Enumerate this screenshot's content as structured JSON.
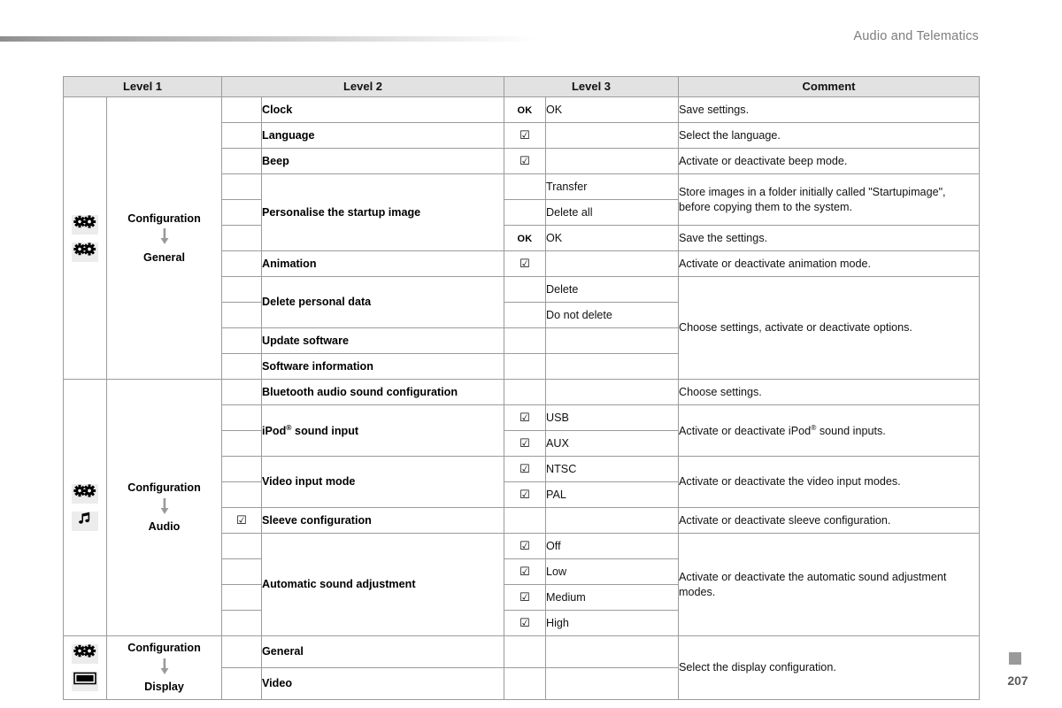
{
  "header": {
    "title": "Audio and Telematics"
  },
  "footer": {
    "page_number": "207"
  },
  "table": {
    "columns": [
      "Level 1",
      "Level 2",
      "Level 3",
      "Comment"
    ],
    "icons": {
      "gear": "gears-icon",
      "music": "music-note-icon",
      "screen": "display-screen-icon"
    },
    "marks": {
      "ok": "OK",
      "checkbox": "☑"
    },
    "sections": [
      {
        "id": "general",
        "icon_top": "gears-icon",
        "icon_bottom": "gears-icon",
        "level1_top": "Configuration",
        "level1_bottom": "General",
        "rows": [
          {
            "level2": "Clock",
            "mark3": "OK",
            "level3": "OK",
            "comment": "Save settings."
          },
          {
            "level2": "Language",
            "mark3": "checkbox",
            "level3": "",
            "comment": "Select the language."
          },
          {
            "level2": "Beep",
            "mark3": "checkbox",
            "level3": "",
            "comment": "Activate or deactivate beep mode."
          },
          {
            "level2": "Personalise the startup image",
            "mark3": "",
            "level3": "Transfer",
            "comment": "Store images in a folder initially called \"Startupimage\", before copying them to the system."
          },
          {
            "level2": "",
            "mark3": "",
            "level3": "Delete all",
            "comment": ""
          },
          {
            "level2": "",
            "mark3": "OK",
            "level3": "OK",
            "comment": "Save the settings."
          },
          {
            "level2": "Animation",
            "mark3": "checkbox",
            "level3": "",
            "comment": "Activate or deactivate animation mode."
          },
          {
            "level2": "Delete personal data",
            "mark3": "",
            "level3": "Delete",
            "comment": "Choose settings, activate or deactivate options."
          },
          {
            "level2": "",
            "mark3": "",
            "level3": "Do not delete",
            "comment": ""
          },
          {
            "level2": "Update software",
            "mark3": "",
            "level3": "",
            "comment": ""
          },
          {
            "level2": "Software information",
            "mark3": "",
            "level3": "",
            "comment": ""
          }
        ]
      },
      {
        "id": "audio",
        "icon_top": "gears-icon",
        "icon_bottom": "music-note-icon",
        "level1_top": "Configuration",
        "level1_bottom": "Audio",
        "rows": [
          {
            "level2": "Bluetooth audio sound configuration",
            "mark3": "",
            "level3": "",
            "comment": "Choose settings."
          },
          {
            "level2": "iPod® sound input",
            "mark3": "checkbox",
            "level3": "USB",
            "comment": "Activate or deactivate iPod® sound inputs."
          },
          {
            "level2": "",
            "mark3": "checkbox",
            "level3": "AUX",
            "comment": ""
          },
          {
            "level2": "Video input mode",
            "mark3": "checkbox",
            "level3": "NTSC",
            "comment": "Activate or deactivate the video input modes."
          },
          {
            "level2": "",
            "mark3": "checkbox",
            "level3": "PAL",
            "comment": ""
          },
          {
            "level2": "Sleeve configuration",
            "mark2": "checkbox",
            "mark3": "",
            "level3": "",
            "comment": "Activate or deactivate sleeve configuration."
          },
          {
            "level2": "Automatic sound adjustment",
            "mark3": "checkbox",
            "level3": "Off",
            "comment": "Activate or deactivate the automatic sound adjustment modes."
          },
          {
            "level2": "",
            "mark3": "checkbox",
            "level3": "Low",
            "comment": ""
          },
          {
            "level2": "",
            "mark3": "checkbox",
            "level3": "Medium",
            "comment": ""
          },
          {
            "level2": "",
            "mark3": "checkbox",
            "level3": "High",
            "comment": ""
          }
        ]
      },
      {
        "id": "display",
        "icon_top": "gears-icon",
        "icon_bottom": "display-screen-icon",
        "level1_top": "Configuration",
        "level1_bottom": "Display",
        "rows": [
          {
            "level2": "General",
            "mark3": "",
            "level3": "",
            "comment": "Select the display configuration."
          },
          {
            "level2": "Video",
            "mark3": "",
            "level3": "",
            "comment": ""
          }
        ]
      }
    ]
  }
}
